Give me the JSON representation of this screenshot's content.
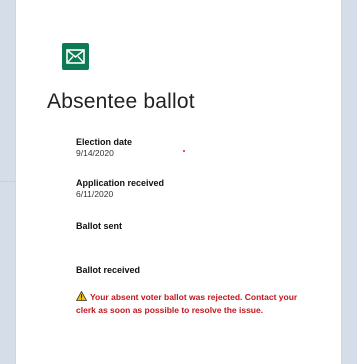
{
  "card": {
    "title": "Absentee ballot",
    "icon": "envelope-icon",
    "accent_color": "#0d7a54"
  },
  "fields": [
    {
      "label": "Election date",
      "value": "9/14/2020"
    },
    {
      "label": "Application received",
      "value": "6/11/2020"
    },
    {
      "label": "Ballot sent",
      "value": ""
    },
    {
      "label": "Ballot received",
      "value": ""
    }
  ],
  "warning": {
    "icon": "warning-icon",
    "text": "Your absent voter ballot was rejected. Contact your clerk as soon as possible to resolve the issue.",
    "color": "#c0171d"
  }
}
